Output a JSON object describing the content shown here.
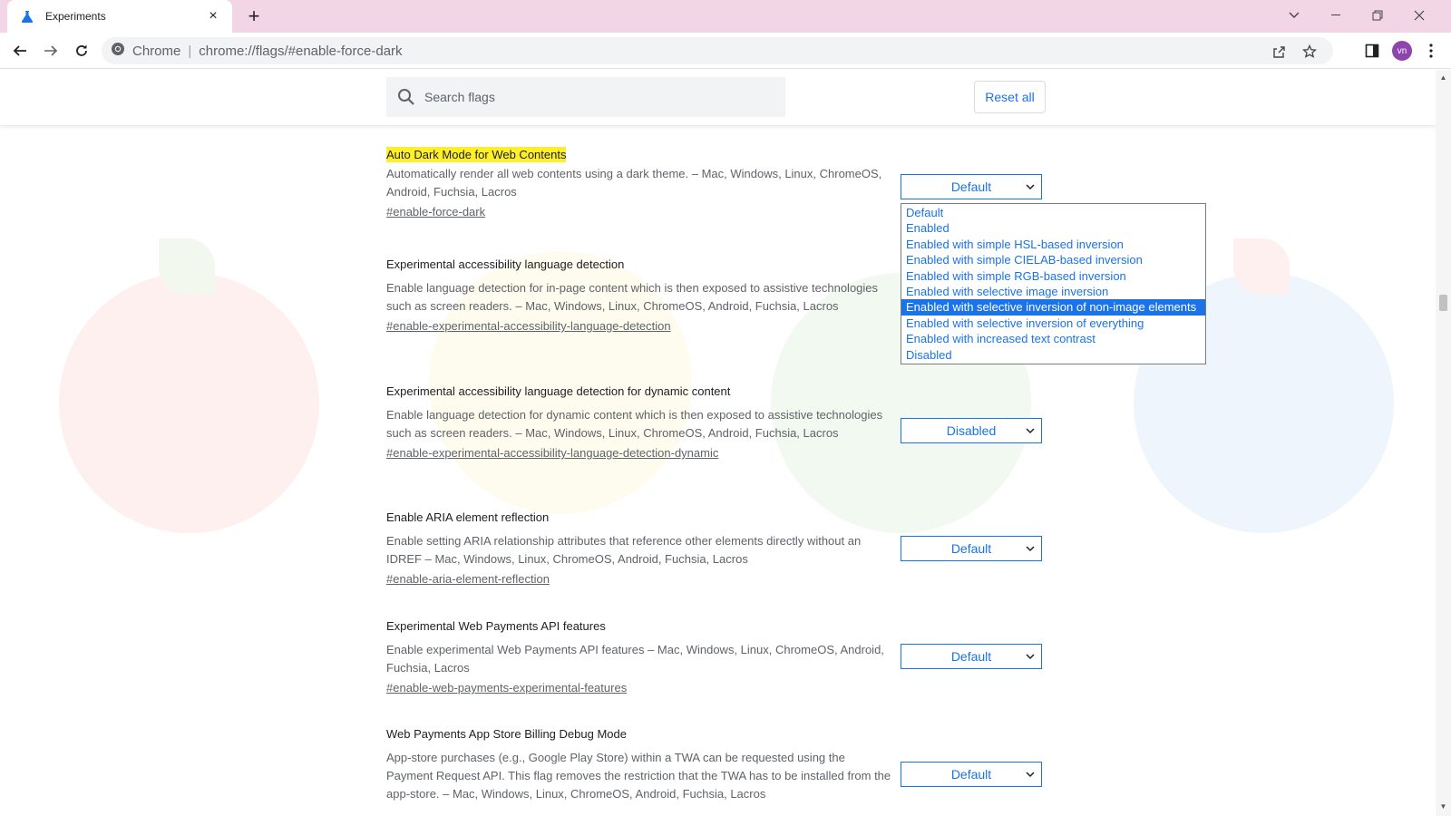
{
  "tab": {
    "title": "Experiments",
    "close": "×",
    "new_tab": "+"
  },
  "window": {
    "minimize": "—",
    "maximize": "❐",
    "close": "✕",
    "tab_search": "⌄"
  },
  "omnibox": {
    "site": "Chrome",
    "separator": "|",
    "url": "chrome://flags/#enable-force-dark"
  },
  "profile": {
    "initials": "vn",
    "color": "#8e44ad"
  },
  "search": {
    "placeholder": "Search flags"
  },
  "reset_label": "Reset all",
  "accent": "#1a73e8",
  "highlight": "#ffef2b",
  "flags": [
    {
      "name": "Auto Dark Mode for Web Contents",
      "desc": "Automatically render all web contents using a dark theme. – Mac, Windows, Linux, ChromeOS, Android, Fuchsia, Lacros",
      "link": "#enable-force-dark",
      "value": "Default"
    },
    {
      "name": "Experimental accessibility language detection",
      "desc": "Enable language detection for in-page content which is then exposed to assistive technologies such as screen readers. – Mac, Windows, Linux, ChromeOS, Android, Fuchsia, Lacros",
      "link": "#enable-experimental-accessibility-language-detection",
      "value": ""
    },
    {
      "name": "Experimental accessibility language detection for dynamic content",
      "desc": "Enable language detection for dynamic content which is then exposed to assistive technologies such as screen readers. – Mac, Windows, Linux, ChromeOS, Android, Fuchsia, Lacros",
      "link": "#enable-experimental-accessibility-language-detection-dynamic",
      "value": "Disabled"
    },
    {
      "name": "Enable ARIA element reflection",
      "desc": "Enable setting ARIA relationship attributes that reference other elements directly without an IDREF – Mac, Windows, Linux, ChromeOS, Android, Fuchsia, Lacros",
      "link": "#enable-aria-element-reflection",
      "value": "Default"
    },
    {
      "name": "Experimental Web Payments API features",
      "desc": "Enable experimental Web Payments API features – Mac, Windows, Linux, ChromeOS, Android, Fuchsia, Lacros",
      "link": "#enable-web-payments-experimental-features",
      "value": "Default"
    },
    {
      "name": "Web Payments App Store Billing Debug Mode",
      "desc": "App-store purchases (e.g., Google Play Store) within a TWA can be requested using the Payment Request API. This flag removes the restriction that the TWA has to be installed from the app-store. – Mac, Windows, Linux, ChromeOS, Android, Fuchsia, Lacros",
      "link": "",
      "value": "Default"
    }
  ],
  "dropdown_options": [
    "Default",
    "Enabled",
    "Enabled with simple HSL-based inversion",
    "Enabled with simple CIELAB-based inversion",
    "Enabled with simple RGB-based inversion",
    "Enabled with selective image inversion",
    "Enabled with selective inversion of non-image elements",
    "Enabled with selective inversion of everything",
    "Enabled with increased text contrast",
    "Disabled"
  ],
  "dropdown_selected": "Enabled with selective inversion of non-image elements"
}
